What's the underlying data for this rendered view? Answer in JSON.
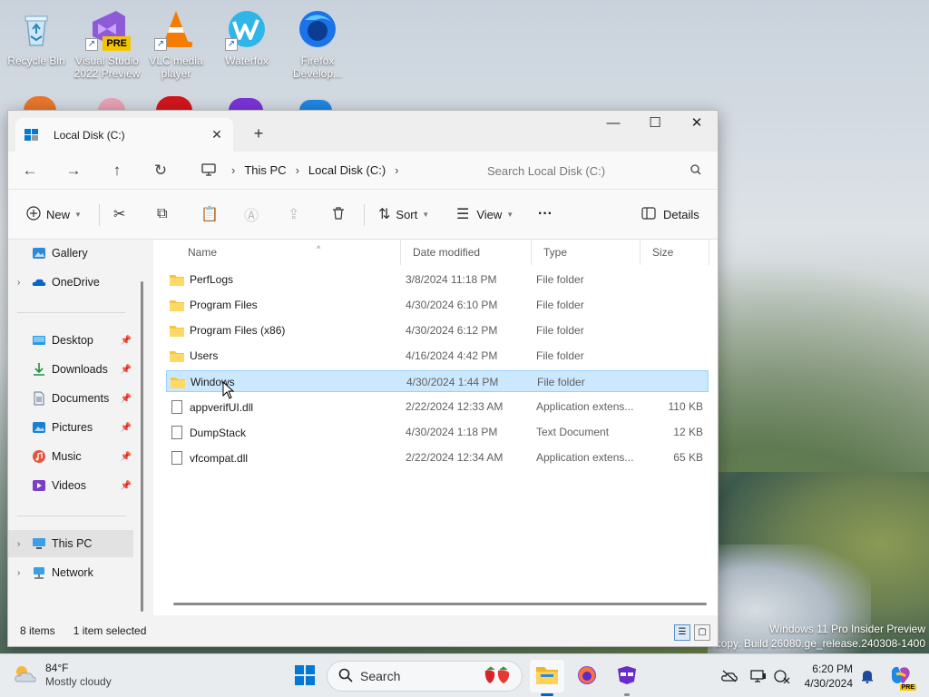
{
  "desktop": {
    "icons": [
      {
        "label": "Recycle Bin",
        "icon": "recycle-bin-icon"
      },
      {
        "label": "Visual Studio 2022 Preview",
        "badge": "PRE",
        "icon": "visual-studio-icon"
      },
      {
        "label": "VLC media player",
        "icon": "vlc-icon"
      },
      {
        "label": "Waterfox",
        "icon": "waterfox-icon"
      },
      {
        "label": "Firefox Develop...",
        "icon": "firefox-dev-icon"
      }
    ],
    "watermark": {
      "line1": "Windows 11 Pro Insider Preview",
      "line2": "n copy. Build 26080.ge_release.240308-1400"
    }
  },
  "explorer": {
    "tab_title": "Local Disk (C:)",
    "breadcrumb": [
      "This PC",
      "Local Disk (C:)"
    ],
    "search_placeholder": "Search Local Disk (C:)",
    "toolbar": {
      "new_label": "New",
      "sort_label": "Sort",
      "view_label": "View",
      "more_label": "···",
      "details_label": "Details"
    },
    "sidebar": {
      "gallery": "Gallery",
      "onedrive": "OneDrive",
      "desktop": "Desktop",
      "downloads": "Downloads",
      "documents": "Documents",
      "pictures": "Pictures",
      "music": "Music",
      "videos": "Videos",
      "thispc": "This PC",
      "network": "Network"
    },
    "columns": {
      "name": "Name",
      "date": "Date modified",
      "type": "Type",
      "size": "Size"
    },
    "files": [
      {
        "name": "PerfLogs",
        "date": "3/8/2024 11:18 PM",
        "type": "File folder",
        "size": ""
      },
      {
        "name": "Program Files",
        "date": "4/30/2024 6:10 PM",
        "type": "File folder",
        "size": ""
      },
      {
        "name": "Program Files (x86)",
        "date": "4/30/2024 6:12 PM",
        "type": "File folder",
        "size": ""
      },
      {
        "name": "Users",
        "date": "4/16/2024 4:42 PM",
        "type": "File folder",
        "size": ""
      },
      {
        "name": "Windows",
        "date": "4/30/2024 1:44 PM",
        "type": "File folder",
        "size": ""
      },
      {
        "name": "appverifUI.dll",
        "date": "2/22/2024 12:33 AM",
        "type": "Application extens...",
        "size": "110 KB"
      },
      {
        "name": "DumpStack",
        "date": "4/30/2024 1:18 PM",
        "type": "Text Document",
        "size": "12 KB"
      },
      {
        "name": "vfcompat.dll",
        "date": "2/22/2024 12:34 AM",
        "type": "Application extens...",
        "size": "65 KB"
      }
    ],
    "status": {
      "items": "8 items",
      "selected": "1 item selected"
    }
  },
  "taskbar": {
    "weather_temp": "84°F",
    "weather_desc": "Mostly cloudy",
    "search_label": "Search",
    "time": "6:20 PM",
    "date": "4/30/2024",
    "pre_badge": "PRE"
  },
  "colors": {
    "accent": "#0067c0",
    "selection": "#cce8ff",
    "folder": "#f4c542"
  }
}
